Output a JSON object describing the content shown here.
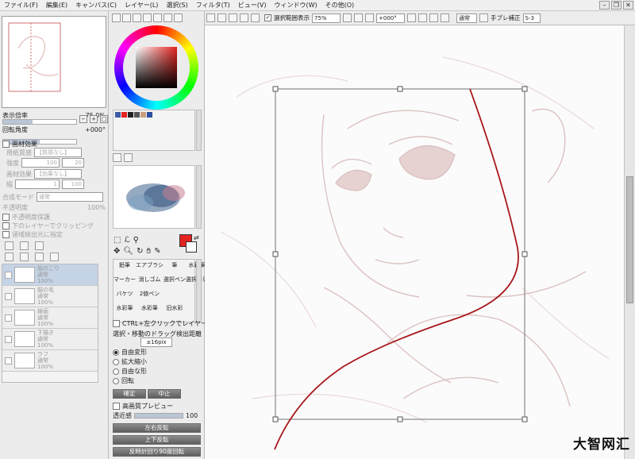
{
  "menu": [
    "ファイル(F)",
    "編集(E)",
    "キャンバス(C)",
    "レイヤー(L)",
    "選択(S)",
    "フィルタ(T)",
    "ビュー(V)",
    "ウィンドウ(W)",
    "その他(O)"
  ],
  "toolbar": {
    "selection_display_label": "選択範囲表示",
    "zoom_value": "75%",
    "rotation_value": "+000°",
    "blend_mode_value": "通常",
    "stabilizer_label": "手ブレ補正",
    "stabilizer_value": "S-3"
  },
  "navigator": {
    "zoom_label": "表示倍率",
    "zoom_value": "75.0%",
    "rotate_label": "回転角度",
    "rotate_value": "+000°"
  },
  "paper_effects": {
    "header": "画材効果",
    "texture_label": "用紙質感",
    "texture_value": "【質感なし】",
    "strength_label": "強度",
    "strength_value": "100",
    "scale_value": "20",
    "effect_label": "画材効果",
    "effect_value": "【効果なし】",
    "width_label": "幅",
    "width_value": "1",
    "strength2_value": "100"
  },
  "layer_props": {
    "blend_label": "合成モード",
    "blend_value": "通常",
    "opacity_label": "不透明度",
    "opacity_value": "100%",
    "protect_opacity": "不透明度保護",
    "clip_group": "下のレイヤーでクリッピング",
    "use_for_detect": "領域検出元に指定"
  },
  "layers": [
    {
      "name": "脳のこり",
      "mode": "通常",
      "opacity": "100%"
    },
    {
      "name": "脳の毛",
      "mode": "通常",
      "opacity": "100%"
    },
    {
      "name": "線画",
      "mode": "通常",
      "opacity": "100%"
    },
    {
      "name": "下描き",
      "mode": "通常",
      "opacity": "100%"
    },
    {
      "name": "ラフ",
      "mode": "通常",
      "opacity": "100%"
    }
  ],
  "tools": {
    "row1": [
      "鉛筆",
      "エアブラシ",
      "筆",
      "水彩筆"
    ],
    "row2": [
      "マーカー",
      "消しゴム",
      "選択ペン",
      "選択消し"
    ],
    "row3": [
      "バケツ",
      "2値ペン"
    ],
    "row4": [
      "水彩筆",
      "水彩筆",
      "旧水彩"
    ]
  },
  "transform": {
    "ctrl_select_label": "CTRL+左クリックでレイヤー選択",
    "drag_label": "選択・移動のドラッグ検出距離",
    "drag_value": "±16pix",
    "options": [
      "自由変形",
      "拡大縮小",
      "自由な形",
      "回転"
    ],
    "selected_option": "自由変形",
    "ok_button": "確定",
    "cancel_button": "中止",
    "hq_preview_label": "高画質プレビュー",
    "distance_label": "透近感",
    "distance_value": "100",
    "flip_h": "左右反転",
    "flip_v": "上下反転",
    "rotate_ccw": "反時計回り90度回転"
  },
  "colors": {
    "primary": "#e3231f",
    "secondary": "#ffffff",
    "accent_selection": "#c5d3e6",
    "swatches": [
      "#3b5ba5",
      "#e3231f",
      "#222222",
      "#555555",
      "#c8a080",
      "#2d4fa0"
    ]
  },
  "watermark": "大智网汇"
}
